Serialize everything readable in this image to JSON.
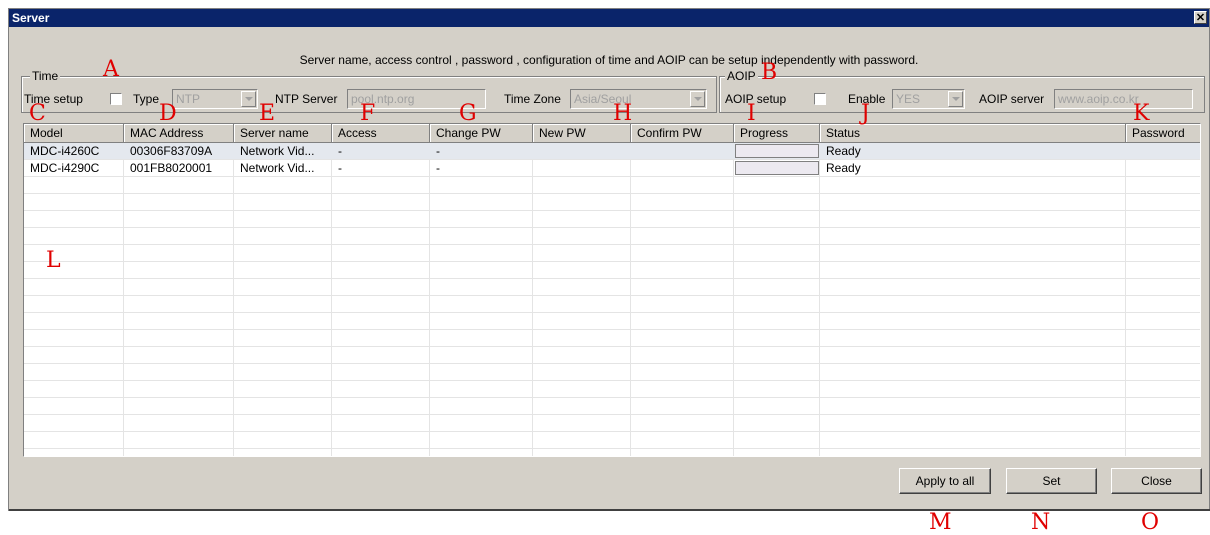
{
  "window": {
    "title": "Server",
    "close_icon": "close-icon"
  },
  "description": "Server name, access control , password , configuration of time and AOIP can be setup independently with password.",
  "time_group": {
    "legend": "Time",
    "time_setup_label": "Time setup",
    "type_label": "Type",
    "type_value": "NTP",
    "ntp_server_label": "NTP Server",
    "ntp_server_value": "pool.ntp.org",
    "time_zone_label": "Time Zone",
    "time_zone_value": "Asia/Seoul"
  },
  "aoip_group": {
    "legend": "AOIP",
    "aoip_setup_label": "AOIP setup",
    "enable_label": "Enable",
    "enable_value": "YES",
    "aoip_server_label": "AOIP server",
    "aoip_server_value": "www.aoip.co.kr"
  },
  "annotations": {
    "A": "A",
    "B": "B",
    "C": "C",
    "D": "D",
    "E": "E",
    "F": "F",
    "G": "G",
    "H": "H",
    "I": "I",
    "J": "J",
    "K": "K",
    "L": "L",
    "M": "M",
    "N": "N",
    "O": "O"
  },
  "table": {
    "columns": [
      "Model",
      "MAC Address",
      "Server name",
      "Access",
      "Change PW",
      "New PW",
      "Confirm PW",
      "Progress",
      "Status",
      "Password"
    ],
    "rows": [
      {
        "model": "MDC-i4260C",
        "mac": "00306F83709A",
        "server_name": "Network Vid...",
        "access": "-",
        "change_pw": "-",
        "new_pw": "",
        "confirm_pw": "",
        "progress": 0,
        "status": "Ready",
        "password": ""
      },
      {
        "model": "MDC-i4290C",
        "mac": "001FB8020001",
        "server_name": "Network Vid...",
        "access": "-",
        "change_pw": "-",
        "new_pw": "",
        "confirm_pw": "",
        "progress": 0,
        "status": "Ready",
        "password": ""
      }
    ]
  },
  "buttons": {
    "apply_all": "Apply to all",
    "set": "Set",
    "close": "Close"
  }
}
